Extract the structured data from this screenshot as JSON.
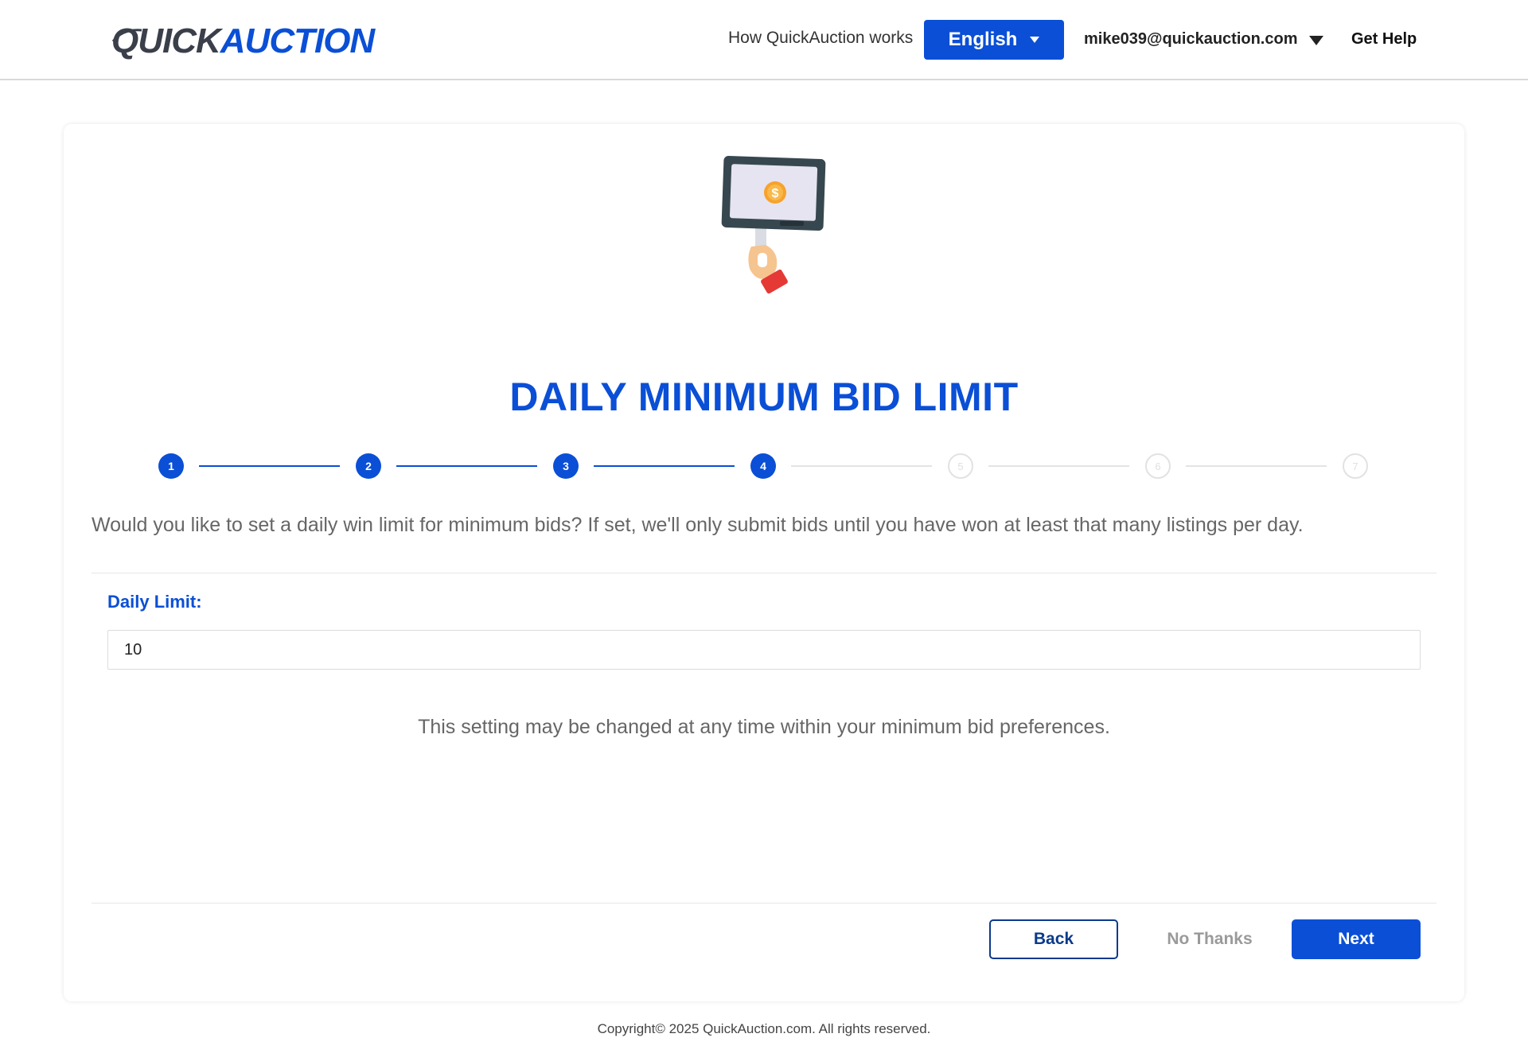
{
  "header": {
    "logo_text_quick": "QUICK",
    "logo_text_auction": "AUCTION",
    "how_it_works": "How QuickAuction works",
    "language": "English",
    "user_email": "mike039@quickauction.com",
    "get_help": "Get Help"
  },
  "main": {
    "title": "DAILY MINIMUM BID LIMIT",
    "steps": [
      {
        "label": "1",
        "state": "done"
      },
      {
        "label": "2",
        "state": "done"
      },
      {
        "label": "3",
        "state": "done"
      },
      {
        "label": "4",
        "state": "current"
      },
      {
        "label": "5",
        "state": "todo"
      },
      {
        "label": "6",
        "state": "todo"
      },
      {
        "label": "7",
        "state": "todo"
      }
    ],
    "current_step": 4,
    "description": "Would you like to set a daily win limit for minimum bids? If set, we'll only submit bids until you have won at least that many listings per day.",
    "daily_limit_label": "Daily Limit:",
    "daily_limit_value": "10",
    "note": "This setting may be changed at any time within your minimum bid preferences."
  },
  "actions": {
    "back": "Back",
    "no_thanks": "No Thanks",
    "next": "Next"
  },
  "footer": {
    "copyright": "Copyright© 2025 QuickAuction.com. All rights reserved."
  },
  "colors": {
    "accent": "#0a4fd6",
    "back_border": "#0a3a8c",
    "muted_text": "#666666"
  },
  "icons": [
    "caret-down-icon",
    "bid-paddle-icon",
    "dollar-coin-icon"
  ]
}
